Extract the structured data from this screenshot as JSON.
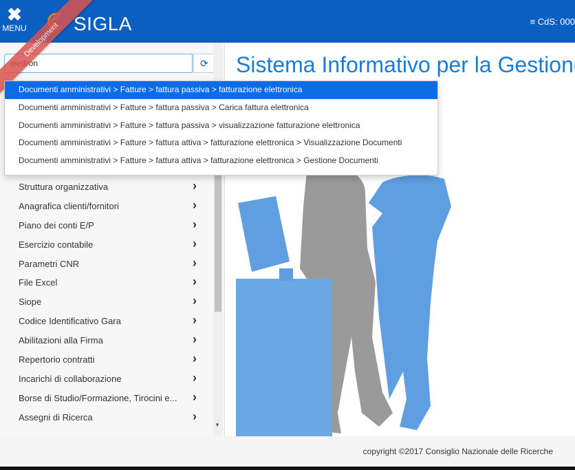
{
  "header": {
    "menu_label": "MENU",
    "brand": "SIGLA",
    "cds_label": "≡ CdS: 000",
    "env_badge": "Development",
    "accent_color": "#0b5fc0",
    "badge_color": "#d9534f"
  },
  "search": {
    "value": "elettron",
    "refresh_icon": "refresh-icon"
  },
  "suggestions": [
    "Documenti amministrativi > Fatture > fattura passiva > fatturazione elettronica",
    "Documenti amministrativi > Fatture > fattura passiva > Carica fattura elettronica",
    "Documenti amministrativi > Fatture > fattura passiva > visualizzazione fatturazione elettronica",
    "Documenti amministrativi > Fatture > fattura attiva > fatturazione elettronica > Visualizzazione Documenti",
    "Documenti amministrativi > Fatture > fattura attiva > fatturazione elettronica > Gestione Documenti"
  ],
  "sidebar": {
    "items": [
      {
        "label": "Struttura organizzativa"
      },
      {
        "label": "Anagrafica clienti/fornitori"
      },
      {
        "label": "Piano dei conti E/P"
      },
      {
        "label": "Esercizio contabile"
      },
      {
        "label": "Parametri CNR"
      },
      {
        "label": "File Excel"
      },
      {
        "label": "Siope"
      },
      {
        "label": "Codice Identificativo Gara"
      },
      {
        "label": "Abilitazioni alla Firma"
      },
      {
        "label": "Repertorio contratti"
      },
      {
        "label": "Incarichi di collaborazione"
      },
      {
        "label": "Borse di Studio/Formazione, Tirocini e..."
      },
      {
        "label": "Assegni di Ricerca"
      }
    ]
  },
  "main": {
    "title": "Sistema Informativo per la Gestione"
  },
  "footer": {
    "copyright": "copyright ©2017 Consiglio Nazionale delle Ricerche"
  }
}
